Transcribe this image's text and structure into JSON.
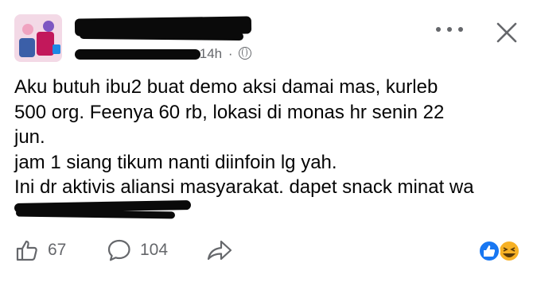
{
  "post": {
    "author": {
      "name": "",
      "subtitle": ""
    },
    "timestamp": "14h",
    "separator": "·",
    "visibility_icon": "globe-icon",
    "lines": [
      "Aku butuh ibu2 buat demo aksi damai mas, kurleb",
      "500 org. Feenya 60 rb, lokasi di monas hr senin 22",
      "jun.",
      "jam 1 siang tikum nanti diinfoin lg yah.",
      "Ini dr aktivis aliansi masyarakat. dapet snack minat wa",
      ""
    ]
  },
  "header_actions": {
    "more_icon": "more-horizontal-icon",
    "close_icon": "close-icon"
  },
  "footer": {
    "likes": "67",
    "comments": "104",
    "like_icon": "thumbs-up-icon",
    "comment_icon": "comment-bubble-icon",
    "share_icon": "share-arrow-icon",
    "reaction_icons": [
      "like-reaction-icon",
      "haha-reaction-icon"
    ]
  },
  "colors": {
    "text": "#050505",
    "secondary": "#65676b",
    "like_blue": "#1877f2",
    "haha_yellow": "#f7b125"
  }
}
